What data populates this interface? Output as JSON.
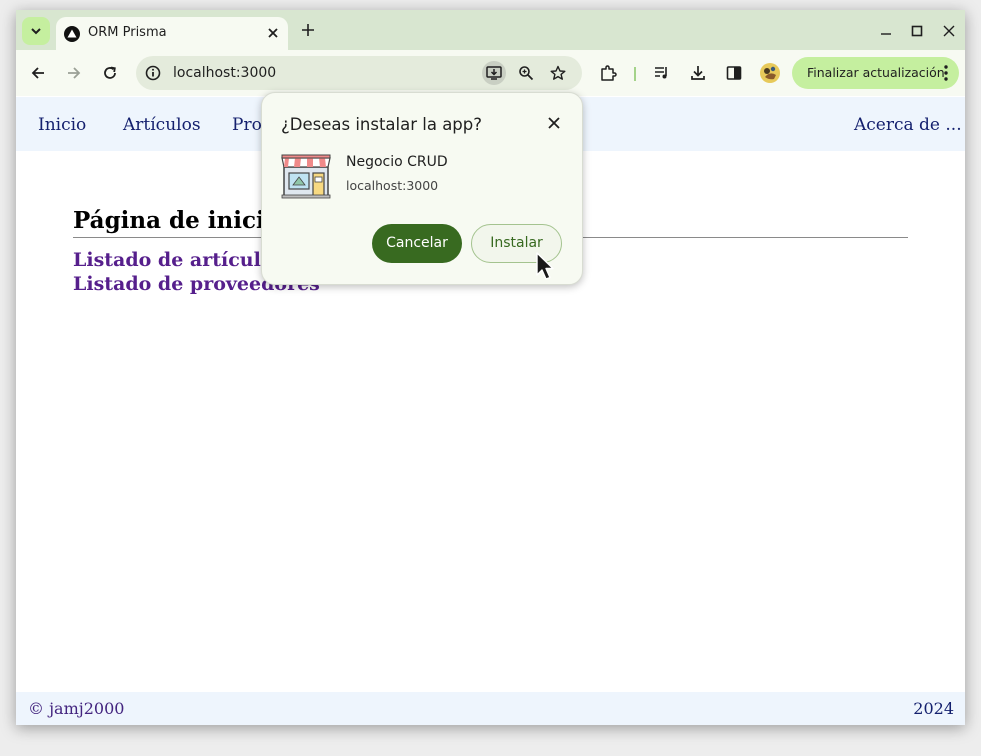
{
  "browser": {
    "tab": {
      "title": "ORM Prisma",
      "favicon": "triangle-circle-icon",
      "close_icon": "close-icon"
    },
    "toolbar": {
      "url": "localhost:3000",
      "update_button_label": "Finalizar actualización",
      "icons": [
        "back-arrow-icon",
        "forward-arrow-icon",
        "reload-icon",
        "site-info-icon",
        "install-app-icon",
        "zoom-icon",
        "bookmark-star-icon",
        "extensions-icon",
        "media-icon",
        "download-icon",
        "side-panel-icon",
        "profile-avatar-icon",
        "more-menu-icon"
      ]
    },
    "colors": {
      "tabbar": "#d8e6d0",
      "toolbar": "#f7faf2",
      "accent": "#386a20",
      "update_button": "#c5ef9f"
    }
  },
  "page": {
    "nav": {
      "items": [
        {
          "label": "Inicio"
        },
        {
          "label": "Artículos"
        },
        {
          "label": "Prov"
        }
      ],
      "about": "Acerca de ..."
    },
    "heading": "Página de inicio",
    "links": [
      {
        "label": "Listado de artículos"
      },
      {
        "label": "Listado de proveedores"
      }
    ],
    "footer": {
      "left": "© jamj2000",
      "right": "2024"
    },
    "colors": {
      "nav_bg": "#eef5fd",
      "link": "#561f8c",
      "nav_link": "#14206e"
    }
  },
  "install_dialog": {
    "title": "¿Deseas instalar la app?",
    "app_name": "Negocio CRUD",
    "app_url": "localhost:3000",
    "app_icon": "storefront-icon",
    "cancel_label": "Cancelar",
    "install_label": "Instalar"
  }
}
